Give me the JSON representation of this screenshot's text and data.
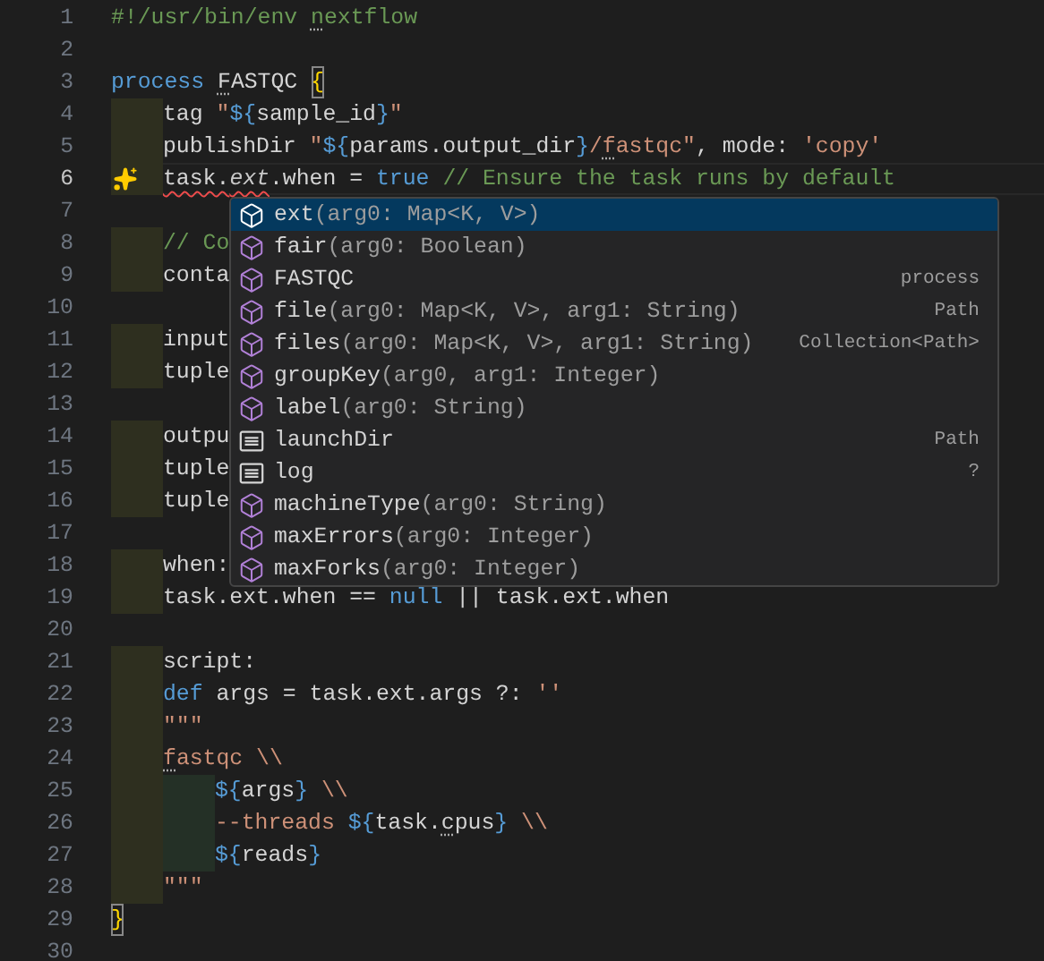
{
  "editor": {
    "lines": [
      {
        "number": "1",
        "current": false,
        "tokens": [
          {
            "kind": "comment",
            "text": "#!/usr/bin/env "
          },
          {
            "kind": "comment",
            "text": "n",
            "hint": true
          },
          {
            "kind": "comment",
            "text": "extflow"
          }
        ]
      },
      {
        "number": "2",
        "current": false
      },
      {
        "number": "3",
        "current": false,
        "tokens": [
          {
            "kind": "keyword",
            "text": "process "
          },
          {
            "kind": "plain",
            "text": "F",
            "hint": true
          },
          {
            "kind": "plain",
            "text": "ASTQC "
          },
          {
            "kind": "bracket",
            "text": "{"
          }
        ]
      },
      {
        "number": "4",
        "current": false,
        "guide": true,
        "tokens": [
          {
            "kind": "plain",
            "text": "tag "
          },
          {
            "kind": "string",
            "text": "\""
          },
          {
            "kind": "interp",
            "text": "${"
          },
          {
            "kind": "plain",
            "text": "sample_id"
          },
          {
            "kind": "interp",
            "text": "}"
          },
          {
            "kind": "string",
            "text": "\""
          }
        ]
      },
      {
        "number": "5",
        "current": false,
        "guide": true,
        "tokens": [
          {
            "kind": "plain",
            "text": "publishDir "
          },
          {
            "kind": "string",
            "text": "\""
          },
          {
            "kind": "interp",
            "text": "${"
          },
          {
            "kind": "plain",
            "text": "params.output_dir"
          },
          {
            "kind": "interp",
            "text": "}"
          },
          {
            "kind": "string",
            "text": "/"
          },
          {
            "kind": "string",
            "text": "f",
            "hint": true
          },
          {
            "kind": "string",
            "text": "astqc\""
          },
          {
            "kind": "plain",
            "text": ", mode: "
          },
          {
            "kind": "string",
            "text": "'copy'"
          }
        ]
      },
      {
        "number": "6",
        "current": true,
        "guide": true,
        "sparkle": true,
        "tokens": [
          {
            "kind": "plain",
            "text": "task.",
            "error": true
          },
          {
            "kind": "italic",
            "text": "ext",
            "error": true
          },
          {
            "kind": "plain",
            "text": ".when = "
          },
          {
            "kind": "keyword",
            "text": "true "
          },
          {
            "kind": "comment",
            "text": "// Ensure the task runs by default"
          }
        ]
      },
      {
        "number": "7",
        "current": false
      },
      {
        "number": "8",
        "current": false,
        "guide": true,
        "tokens": [
          {
            "kind": "comment",
            "text": "// Co"
          }
        ]
      },
      {
        "number": "9",
        "current": false,
        "guide": true,
        "tokens": [
          {
            "kind": "plain",
            "text": "conta"
          }
        ]
      },
      {
        "number": "10",
        "current": false
      },
      {
        "number": "11",
        "current": false,
        "guide": true,
        "tokens": [
          {
            "kind": "plain",
            "text": "input"
          }
        ]
      },
      {
        "number": "12",
        "current": false,
        "guide": true,
        "tokens": [
          {
            "kind": "plain",
            "text": "tuple"
          }
        ]
      },
      {
        "number": "13",
        "current": false
      },
      {
        "number": "14",
        "current": false,
        "guide": true,
        "tokens": [
          {
            "kind": "plain",
            "text": "outpu"
          }
        ]
      },
      {
        "number": "15",
        "current": false,
        "guide": true,
        "tokens": [
          {
            "kind": "plain",
            "text": "tuple"
          }
        ]
      },
      {
        "number": "16",
        "current": false,
        "guide": true,
        "tokens": [
          {
            "kind": "plain",
            "text": "tuple"
          }
        ]
      },
      {
        "number": "17",
        "current": false
      },
      {
        "number": "18",
        "current": false,
        "guide": true,
        "tokens": [
          {
            "kind": "plain",
            "text": "when:"
          }
        ]
      },
      {
        "number": "19",
        "current": false,
        "guide": true,
        "tokens": [
          {
            "kind": "plain",
            "text": "task.ext.when == "
          },
          {
            "kind": "keyword",
            "text": "null"
          },
          {
            "kind": "plain",
            "text": " || task.ext.when"
          }
        ]
      },
      {
        "number": "20",
        "current": false
      },
      {
        "number": "21",
        "current": false,
        "guide": true,
        "tokens": [
          {
            "kind": "plain",
            "text": "script:"
          }
        ]
      },
      {
        "number": "22",
        "current": false,
        "guide": true,
        "tokens": [
          {
            "kind": "keyword",
            "text": "def "
          },
          {
            "kind": "plain",
            "text": "args = task.ext.args ?: "
          },
          {
            "kind": "string",
            "text": "''"
          }
        ]
      },
      {
        "number": "23",
        "current": false,
        "guide": true,
        "tokens": [
          {
            "kind": "string",
            "text": "\"\"\""
          }
        ]
      },
      {
        "number": "24",
        "current": false,
        "guide": true,
        "tokens": [
          {
            "kind": "string",
            "text": "f",
            "hint": true
          },
          {
            "kind": "string",
            "text": "astqc \\\\"
          }
        ]
      },
      {
        "number": "25",
        "current": false,
        "guide": true,
        "guide2": true,
        "tokens": [
          {
            "kind": "interp",
            "text": "${"
          },
          {
            "kind": "plain",
            "text": "args"
          },
          {
            "kind": "interp",
            "text": "}"
          },
          {
            "kind": "string",
            "text": " \\\\"
          }
        ]
      },
      {
        "number": "26",
        "current": false,
        "guide": true,
        "guide2": true,
        "tokens": [
          {
            "kind": "string",
            "text": "--threads "
          },
          {
            "kind": "interp",
            "text": "${"
          },
          {
            "kind": "plain",
            "text": "task."
          },
          {
            "kind": "plain",
            "text": "c",
            "hint": true
          },
          {
            "kind": "plain",
            "text": "pus"
          },
          {
            "kind": "interp",
            "text": "}"
          },
          {
            "kind": "string",
            "text": " \\\\"
          }
        ]
      },
      {
        "number": "27",
        "current": false,
        "guide": true,
        "guide2": true,
        "tokens": [
          {
            "kind": "interp",
            "text": "${"
          },
          {
            "kind": "plain",
            "text": "reads"
          },
          {
            "kind": "interp",
            "text": "}"
          }
        ]
      },
      {
        "number": "28",
        "current": false,
        "guide": true,
        "tokens": [
          {
            "kind": "string",
            "text": "\"\"\""
          }
        ]
      },
      {
        "number": "29",
        "current": false,
        "tokens": [
          {
            "kind": "bracket",
            "text": "}"
          }
        ]
      },
      {
        "number": "30",
        "current": false
      }
    ]
  },
  "suggestions": [
    {
      "kind": "method",
      "name": "ext",
      "signature": "(arg0: Map<K, V>)",
      "selected": true
    },
    {
      "kind": "method",
      "name": "fair",
      "signature": "(arg0: Boolean)",
      "selected": false
    },
    {
      "kind": "method",
      "name": "FASTQC",
      "detail": "process",
      "selected": false
    },
    {
      "kind": "method",
      "name": "file",
      "signature": "(arg0: Map<K, V>, arg1: String)",
      "detail": "Path",
      "selected": false
    },
    {
      "kind": "method",
      "name": "files",
      "signature": "(arg0: Map<K, V>, arg1: String)",
      "detail": "Collection<Path>",
      "selected": false
    },
    {
      "kind": "method",
      "name": "groupKey",
      "signature": "(arg0, arg1: Integer)",
      "selected": false
    },
    {
      "kind": "method",
      "name": "label",
      "signature": "(arg0: String)",
      "selected": false
    },
    {
      "kind": "field",
      "name": "launchDir",
      "detail": "Path",
      "selected": false
    },
    {
      "kind": "field",
      "name": "log",
      "detail": "?",
      "selected": false
    },
    {
      "kind": "method",
      "name": "machineType",
      "signature": "(arg0: String)",
      "selected": false
    },
    {
      "kind": "method",
      "name": "maxErrors",
      "signature": "(arg0: Integer)",
      "selected": false
    },
    {
      "kind": "method",
      "name": "maxForks",
      "signature": "(arg0: Integer)",
      "selected": false
    }
  ]
}
